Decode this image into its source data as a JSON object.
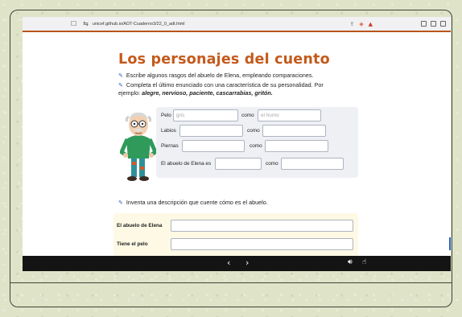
{
  "browser": {
    "url": "unicef.github.io/ADT-Cuaderno3/22_0_adt.html",
    "accent": "#b8541c"
  },
  "page": {
    "title": "Los personajes del cuento",
    "title_color": "#c45a1c",
    "instructions": [
      "Escribe algunos rasgos del abuelo de Elena, empleando comparaciones.",
      "Completa el último enunciado con una característica de su personalidad. Por",
      "ejemplo: ",
      "alegre, nervioso, paciente, cascarrabias, gritón."
    ],
    "comparisons": {
      "rows": [
        {
          "label": "Pelo",
          "value_placeholder": "gris",
          "como": "como",
          "compare_placeholder": "el humo"
        },
        {
          "label": "Labios",
          "value_placeholder": "",
          "como": "como",
          "compare_placeholder": ""
        },
        {
          "label": "Piernas",
          "value_placeholder": "",
          "como": "como",
          "compare_placeholder": ""
        },
        {
          "label": "El abuelo de Elena es",
          "value_placeholder": "",
          "como": "como",
          "compare_placeholder": ""
        }
      ]
    },
    "description_prompt": "Inventa una descripción que cuente cómo es el abuelo.",
    "description": {
      "rows": [
        {
          "label": "El abuelo de Elena",
          "value": ""
        },
        {
          "label": "Tiene el pelo",
          "value": ""
        }
      ]
    }
  },
  "icons": {
    "edit": "pencil-square-icon",
    "prev": "chevron-left-icon",
    "next": "chevron-right-icon",
    "audio": "speaker-icon",
    "accessibility": "accessibility-icon"
  }
}
